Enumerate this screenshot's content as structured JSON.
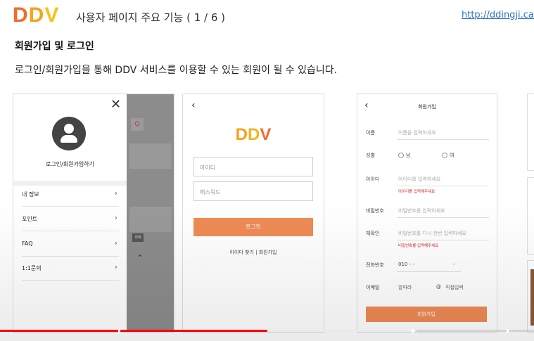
{
  "header": {
    "logo": {
      "d1": "D",
      "d2": "D",
      "v": "V"
    },
    "title": "사용자 페이지 주요 기능 ( 1 / 6 )",
    "url": "http://ddingji.cafe"
  },
  "section": {
    "title": "회원가입 및 로그인",
    "description": "로그인/회원가입을 통해 DDV 서비스를 이용할 수 있는 회원이 될 수 있습니다."
  },
  "menu_panel": {
    "close": "✕",
    "login_label": "로그인/회원가입하기",
    "items": [
      {
        "label": "내 정보",
        "chevron": "›"
      },
      {
        "label": "포인트",
        "chevron": "›"
      },
      {
        "label": "FAQ",
        "chevron": "›"
      },
      {
        "label": "1:1문의",
        "chevron": "›"
      }
    ],
    "overlay": {
      "search_glyph": "Q",
      "badge": "전체",
      "up": "⌃"
    }
  },
  "login_panel": {
    "back": "‹",
    "brand": {
      "d1": "D",
      "d2": "D",
      "v": "V"
    },
    "id_placeholder": "아이디",
    "password_placeholder": "패스워드",
    "login_button": "로그인",
    "links": "아이디 찾기 | 회원가입"
  },
  "signup_panel": {
    "back": "‹",
    "title": "회원가입",
    "fields": {
      "name": {
        "label": "이름",
        "placeholder": "이름을 입력하세요"
      },
      "gender": {
        "label": "성별",
        "male": "남",
        "female": "여"
      },
      "id": {
        "label": "아이디",
        "placeholder": "아이디를 입력하세요",
        "error": "아이디를 입력해주세요"
      },
      "password": {
        "label": "비밀번호",
        "placeholder": "비밀번호를 입력하세요"
      },
      "confirm": {
        "label": "재확인",
        "placeholder": "비밀번호를 다시 한번 입력하세요",
        "error": "비밀번호를 입력해주세요"
      },
      "phone": {
        "label": "전화번호",
        "value": "010  -  -",
        "dash": "-"
      },
      "email": {
        "label": "이메일",
        "local": "알파라",
        "at": "@",
        "domain": "직접입력"
      }
    },
    "join_button": "회원가입"
  },
  "video": {
    "played_fraction": 0.5,
    "buffered_fraction": 0.78
  },
  "colors": {
    "accent_orange": "#ef8a55",
    "logo_orange": "#f26c2b",
    "logo_yellow": "#f6a21c",
    "error_red": "#d4242a",
    "progress_red": "#ff0000"
  }
}
